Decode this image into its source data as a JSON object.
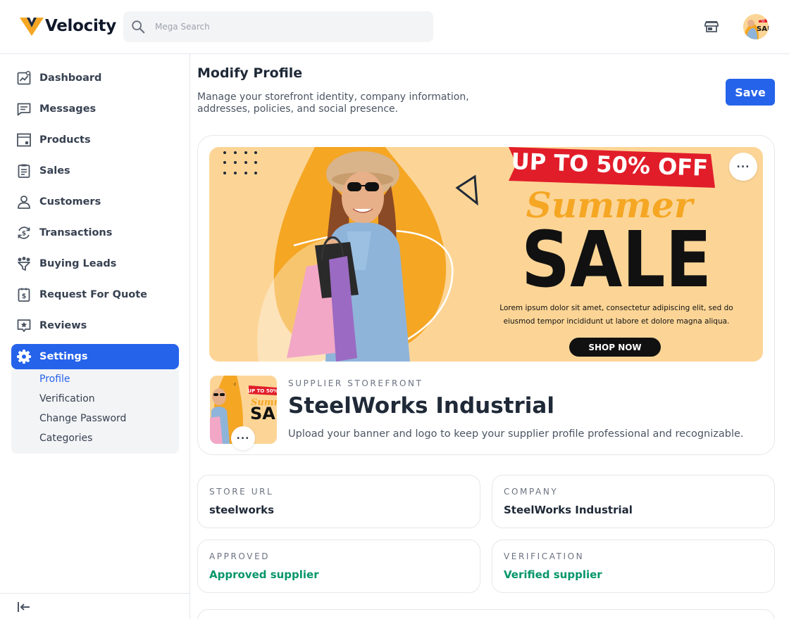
{
  "app": {
    "name": "Velocity"
  },
  "search": {
    "placeholder": "Mega Search"
  },
  "sidebar": {
    "items": [
      {
        "label": "Dashboard",
        "icon": "dashboard-icon"
      },
      {
        "label": "Messages",
        "icon": "messages-icon"
      },
      {
        "label": "Products",
        "icon": "products-icon"
      },
      {
        "label": "Sales",
        "icon": "sales-icon"
      },
      {
        "label": "Customers",
        "icon": "customers-icon"
      },
      {
        "label": "Transactions",
        "icon": "transactions-icon"
      },
      {
        "label": "Buying Leads",
        "icon": "buying-leads-icon"
      },
      {
        "label": "Request For Quote",
        "icon": "request-for-quote-icon"
      },
      {
        "label": "Reviews",
        "icon": "reviews-icon"
      },
      {
        "label": "Settings",
        "icon": "settings-icon",
        "active": true
      }
    ],
    "settings_sub": [
      {
        "label": "Profile",
        "active": true
      },
      {
        "label": "Verification"
      },
      {
        "label": "Change Password"
      },
      {
        "label": "Categories"
      }
    ]
  },
  "main": {
    "title": "Modify Profile",
    "description": "Manage your storefront identity, company information, addresses, policies, and social presence.",
    "save_label": "Save",
    "banner": {
      "ribbon": "UP TO 50% OFF",
      "script_word": "Summer",
      "headline": "SALE",
      "body_line1": "Lorem ipsum dolor sit amet, consectetur adipiscing elit, sed do",
      "body_line2": "eiusmod tempor incididunt ut labore et dolore magna aliqua.",
      "cta": "SHOP NOW"
    },
    "logo_thumb": {
      "ribbon": "UP TO 50%",
      "script_word": "Summ",
      "headline": "SAL",
      "letter": "c"
    },
    "avatar": {
      "ribbon": "50",
      "headline": "SAI"
    },
    "eyebrow": "SUPPLIER STOREFRONT",
    "store_name": "SteelWorks Industrial",
    "store_help": "Upload your banner and logo to keep your supplier profile professional and recognizable.",
    "info": [
      {
        "label": "STORE URL",
        "value": "steelworks",
        "status": false
      },
      {
        "label": "COMPANY",
        "value": "SteelWorks Industrial",
        "status": false
      },
      {
        "label": "APPROVED",
        "value": "Approved supplier",
        "status": true
      },
      {
        "label": "VERIFICATION",
        "value": "Verified supplier",
        "status": true
      }
    ]
  },
  "colors": {
    "primary": "#2563eb",
    "success": "#059669",
    "banner_bg": "#fcd596",
    "ribbon_red": "#e11d2a",
    "accent_orange": "#f5a623"
  }
}
